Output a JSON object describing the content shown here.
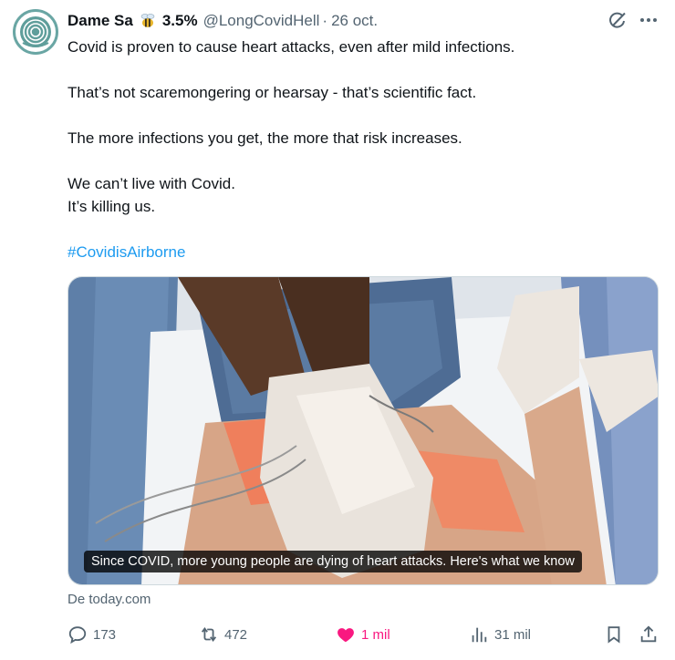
{
  "author": {
    "name": "Dame Sa",
    "badge_text": "3.5%",
    "handle": "@LongCovidHell",
    "separator": "·",
    "date": "26 oct."
  },
  "tweet": {
    "lines": [
      "Covid is proven to cause heart attacks, even after mild infections.",
      "That’s not scaremongering or hearsay - that’s scientific fact.",
      "The more infections you get, the more that risk increases.",
      "We can’t live with Covid.",
      "It’s killing us."
    ],
    "hashtag": "#CovidisAirborne"
  },
  "card": {
    "caption": "Since COVID, more young people are dying of heart attacks. Here's what we know",
    "source": "De today.com"
  },
  "actions": {
    "replies": "173",
    "retweets": "472",
    "likes": "1 mil",
    "views": "31 mil"
  },
  "colors": {
    "link": "#1d9bf0",
    "like": "#f91880",
    "muted": "#536471",
    "text": "#0f1419"
  },
  "icons": [
    "avatar-logo",
    "bee-icon",
    "grok-icon",
    "more-icon",
    "reply-icon",
    "retweet-icon",
    "heart-icon",
    "views-icon",
    "bookmark-icon",
    "share-icon"
  ]
}
